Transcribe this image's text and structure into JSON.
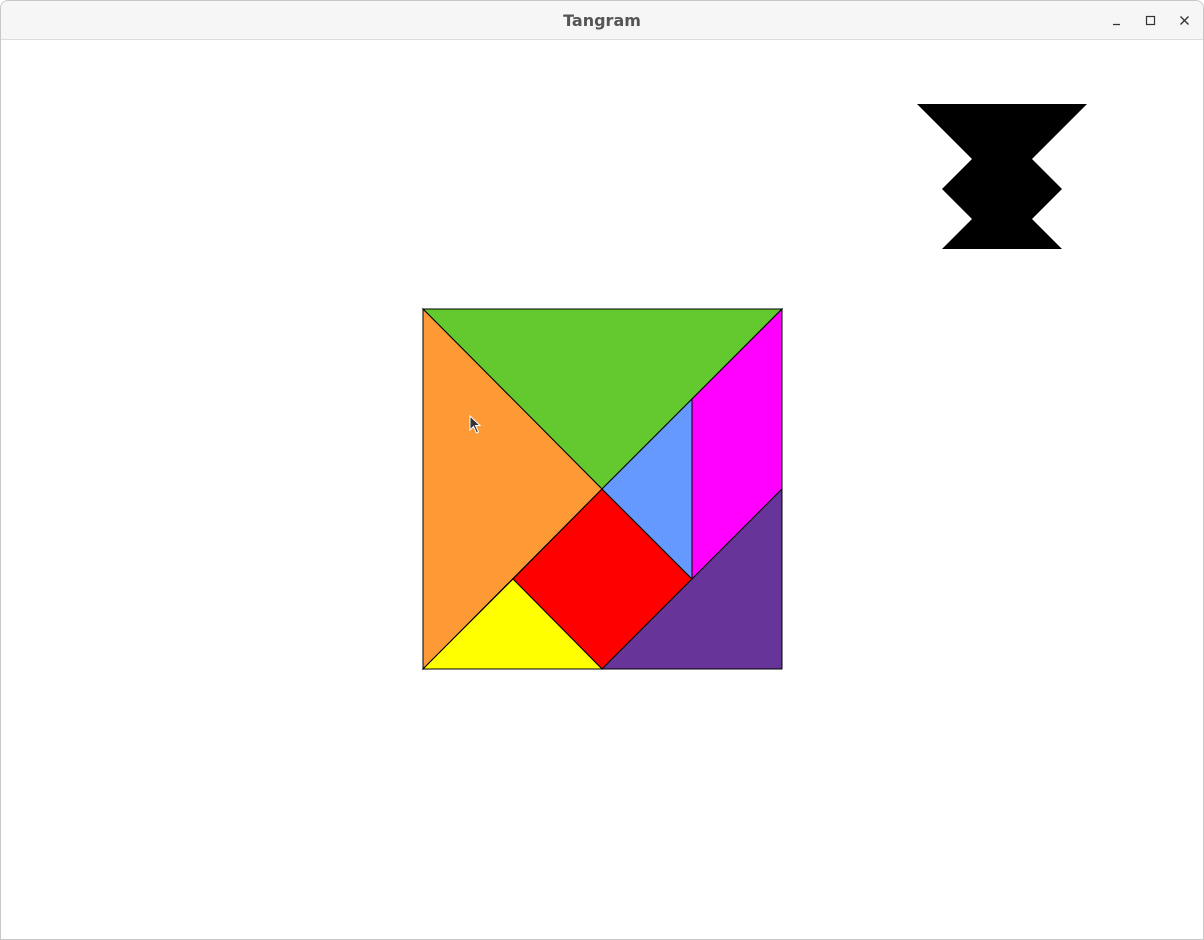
{
  "window": {
    "title": "Tangram",
    "controls": [
      "minimize-icon",
      "maximize-icon",
      "close-icon"
    ]
  },
  "target_shape": {
    "color": "#000000"
  },
  "pieces": {
    "large_triangle_top": {
      "color": "#63c92f"
    },
    "large_triangle_left": {
      "color": "#fd9a35"
    },
    "square": {
      "color": "#ff0000"
    },
    "small_triangle_blue": {
      "color": "#6699ff"
    },
    "parallelogram": {
      "color": "#ff00ff"
    },
    "medium_triangle": {
      "color": "#673499"
    },
    "small_triangle_yellow": {
      "color": "#ffff00"
    }
  },
  "outline_color": "#000000"
}
